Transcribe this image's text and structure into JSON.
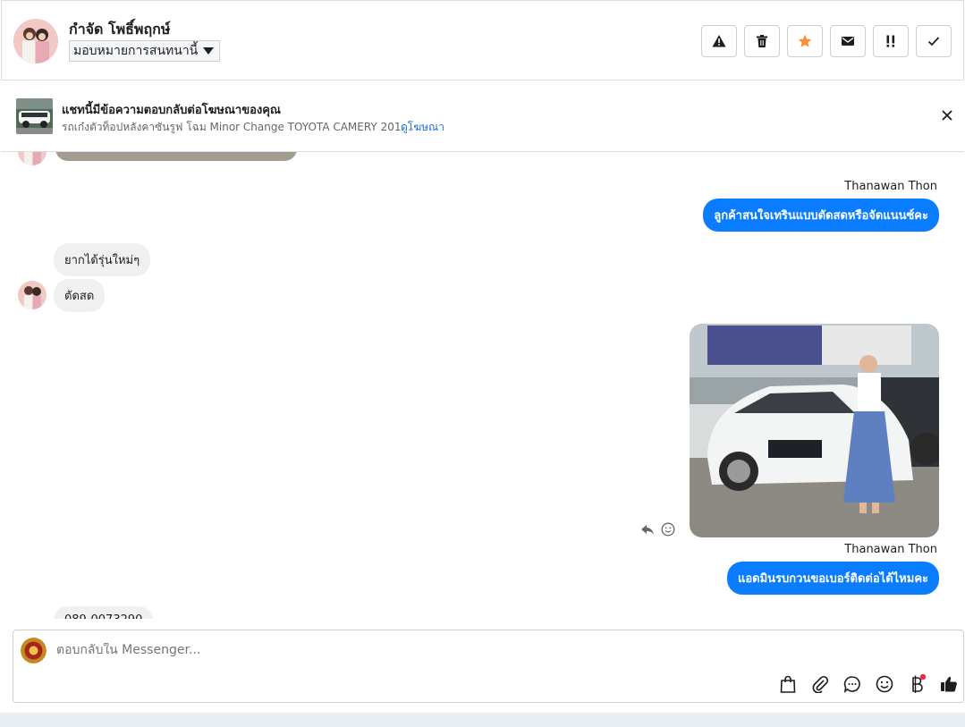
{
  "header": {
    "contact_name": "กำจัด โพธิ์พฤกษ์",
    "assign_label": "มอบหมายการสนทนานี้",
    "tools": [
      "spam-icon",
      "trash-icon",
      "star-icon",
      "mail-icon",
      "follow-up-icon",
      "done-icon"
    ],
    "star_color": "#f7923b"
  },
  "ad": {
    "title": "แชทนี้มีข้อความตอบกลับต่อโฆษณาของคุณ",
    "description": "รถเก๋งตัวท็อปหลังคาซันรูฟ โฉม Minor Change TOYOTA CAMERY 201...",
    "link": "ดูโฆษณา"
  },
  "messages": {
    "sender_1": "Thanawan Thon",
    "out_1": "ลูกค้าสนใจเทรินแบบตัดสดหรือจัดแนนซ์คะ",
    "in_1": "ยากได้รุ่นใหม่ๆ",
    "in_2": "ตัดสด",
    "sender_2": "Thanawan Thon",
    "out_2": "แอดมินรบกวนขอเบอร์ติดต่อได้ไหมคะ",
    "in_3_partial": "089-0073290"
  },
  "composer": {
    "placeholder": "ตอบกลับใน Messenger...",
    "icons": [
      "bag-icon",
      "attachment-icon",
      "saved-reply-icon",
      "emoji-icon",
      "baht-icon",
      "thumbs-up-icon"
    ],
    "accent": "#0a7cff"
  }
}
